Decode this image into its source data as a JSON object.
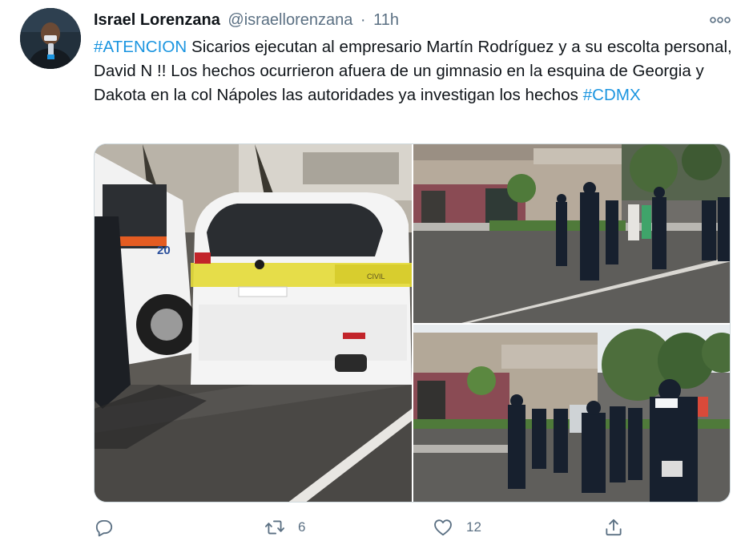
{
  "author": {
    "display_name": "Israel Lorenzana",
    "handle": "@israellorenzana",
    "separator": "·",
    "time": "11h"
  },
  "tweet": {
    "hashtag_1": "#ATENCION",
    "text_body": " Sicarios ejecutan al empresario Martín Rodríguez y a su escolta personal, David N !! Los hechos ocurrieron afuera de un gimnasio en la esquina de Georgia y Dakota en la col Nápoles las autoridades ya investigan los hechos ",
    "hashtag_2": "#CDMX"
  },
  "actions": {
    "reply_icon": "reply-icon",
    "retweet_icon": "retweet-icon",
    "retweet_count": "6",
    "like_icon": "heart-icon",
    "like_count": "12",
    "share_icon": "share-icon"
  },
  "colors": {
    "hashtag": "#1b95e0",
    "secondary_text": "#5b7083",
    "primary_text": "#0f1419"
  }
}
